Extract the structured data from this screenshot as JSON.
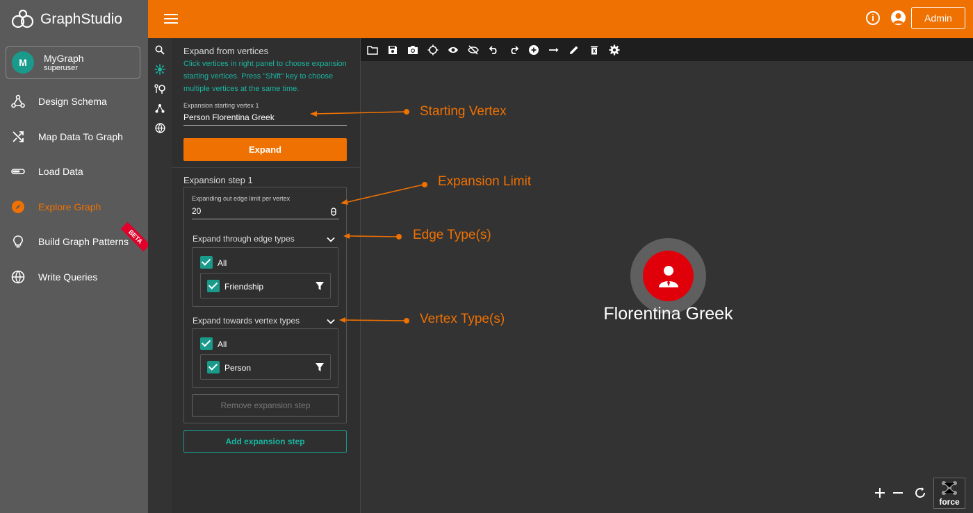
{
  "app": {
    "title": "GraphStudio",
    "admin_label": "Admin"
  },
  "graph": {
    "initial": "M",
    "name": "MyGraph",
    "role": "superuser"
  },
  "sidebar": {
    "items": [
      {
        "label": "Design Schema",
        "icon": "schema-icon"
      },
      {
        "label": "Map Data To Graph",
        "icon": "shuffle-icon"
      },
      {
        "label": "Load Data",
        "icon": "progress-icon"
      },
      {
        "label": "Explore Graph",
        "icon": "compass-icon",
        "active": true
      },
      {
        "label": "Build Graph Patterns",
        "icon": "bulb-icon",
        "badge": "BETA"
      },
      {
        "label": "Write Queries",
        "icon": "globe-icon"
      }
    ]
  },
  "panel": {
    "title": "Expand from vertices",
    "help": "Click vertices in right panel to choose expansion starting vertices. Press \"Shift\" key to choose multiple vertices at the same time.",
    "start_label": "Expansion starting vertex 1",
    "start_value": "Person Florentina Greek",
    "expand_label": "Expand",
    "step_title": "Expansion step 1",
    "limit_label": "Expanding out edge limit per vertex",
    "limit_value": "20",
    "edge_header": "Expand through edge types",
    "edge_all": "All",
    "edge_type": "Friendship",
    "vertex_header": "Expand towards vertex types",
    "vertex_all": "All",
    "vertex_type": "Person",
    "remove_label": "Remove expansion step",
    "add_label": "Add expansion step"
  },
  "canvas": {
    "node_label": "Florentina Greek",
    "force_label": "force"
  },
  "annotations": {
    "starting_vertex": "Starting Vertex",
    "expansion_limit": "Expansion Limit",
    "edge_types": "Edge Type(s)",
    "vertex_types": "Vertex Type(s)"
  },
  "colors": {
    "brand": "#ef7102",
    "teal": "#1a9a8a",
    "node": "#e0000a"
  }
}
